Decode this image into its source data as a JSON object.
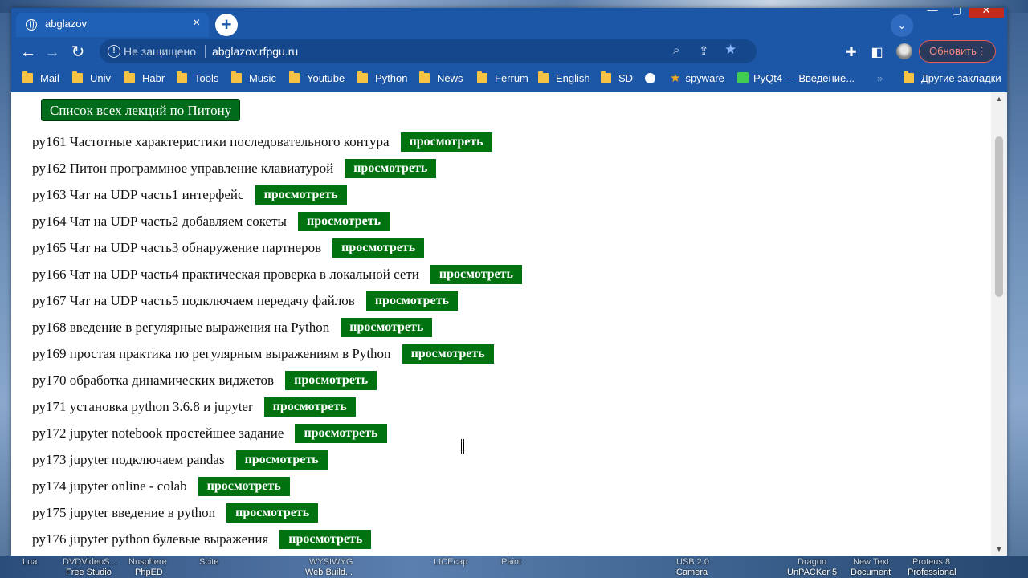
{
  "browser": {
    "tab_title": "abglazov",
    "tab_close": "×",
    "new_tab": "+",
    "security_label": "Не защищено",
    "url": "abglazov.rfpgu.ru",
    "update_label": "Обновить",
    "bookmarks": [
      {
        "label": "Mail",
        "icon": "folder"
      },
      {
        "label": "Univ",
        "icon": "folder"
      },
      {
        "label": "Habr",
        "icon": "folder"
      },
      {
        "label": "Tools",
        "icon": "folder"
      },
      {
        "label": "Music",
        "icon": "folder"
      },
      {
        "label": "Youtube",
        "icon": "folder"
      },
      {
        "label": "Python",
        "icon": "folder"
      },
      {
        "label": "News",
        "icon": "folder"
      },
      {
        "label": "Ferrum",
        "icon": "folder"
      },
      {
        "label": "English",
        "icon": "folder"
      },
      {
        "label": "SD",
        "icon": "folder"
      },
      {
        "label": "",
        "icon": "globe"
      },
      {
        "label": "spyware",
        "icon": "star"
      },
      {
        "label": "PyQt4 — Введение...",
        "icon": "qt"
      },
      {
        "label": "Другие закладки",
        "icon": "folder"
      }
    ],
    "more_bookmarks": "»"
  },
  "page": {
    "all_lectures_button": "Список всех лекций по Питону",
    "lectures": [
      {
        "title": "py161 Частотные характеристики последовательного контура",
        "button": "просмотреть"
      },
      {
        "title": "py162 Питон программное управление клавиатурой",
        "button": "просмотреть"
      },
      {
        "title": "py163 Чат на UDP часть1 интерфейс",
        "button": "просмотреть"
      },
      {
        "title": "py164 Чат на UDP часть2 добавляем сокеты",
        "button": "просмотреть"
      },
      {
        "title": "py165 Чат на UDP часть3 обнаружение партнеров",
        "button": "просмотреть"
      },
      {
        "title": "py166 Чат на UDP часть4 практическая проверка в локальной сети",
        "button": "просмотреть"
      },
      {
        "title": "py167 Чат на UDP часть5 подключаем передачу файлов",
        "button": "просмотреть"
      },
      {
        "title": "py168 введение в регулярные выражения на Python",
        "button": "просмотреть"
      },
      {
        "title": "py169 простая практика по регулярным выражениям в Python",
        "button": "просмотреть"
      },
      {
        "title": "py170 обработка динамических виджетов",
        "button": "просмотреть"
      },
      {
        "title": "py171 установка python 3.6.8 и jupyter",
        "button": "просмотреть"
      },
      {
        "title": "py172 jupyter notebook простейшее задание",
        "button": "просмотреть"
      },
      {
        "title": "py173 jupyter подключаем pandas",
        "button": "просмотреть"
      },
      {
        "title": "py174 jupyter online - colab",
        "button": "просмотреть"
      },
      {
        "title": "py175 jupyter введение в python",
        "button": "просмотреть"
      },
      {
        "title": "py176 jupyter python булевые выражения",
        "button": "просмотреть"
      }
    ]
  },
  "desktop": {
    "labels_top": [
      "Lua",
      "DVDVideoS...",
      "Nusphere",
      "Scite",
      "WYSIWYG",
      "LICEcap",
      "Paint",
      "USB 2.0",
      "Dragon",
      "New Text",
      "Proteus 8"
    ],
    "labels_bottom": [
      "Free Studio",
      "PhpED",
      "Web Build...",
      "Camera",
      "UnPACKer 5",
      "Document",
      "Professional"
    ]
  },
  "colors": {
    "frame": "#1c56a6",
    "button_green": "#00720f",
    "update_outline": "#e05b52"
  }
}
